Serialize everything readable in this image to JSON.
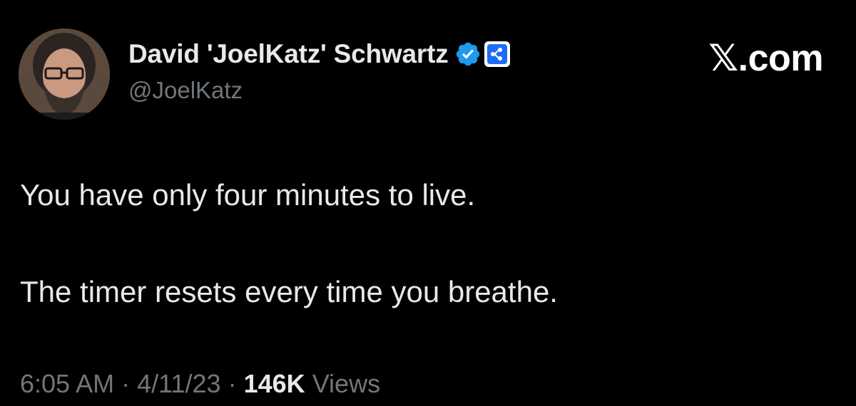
{
  "author": {
    "display_name": "David 'JoelKatz' Schwartz",
    "handle": "@JoelKatz",
    "verified_color": "#1d9bf0",
    "affiliate_color": "#1d6cf5"
  },
  "brand": {
    "label": "𝕏.com"
  },
  "tweet": {
    "lines": [
      "You have only four minutes to live.",
      "The timer resets every time you breathe."
    ]
  },
  "meta": {
    "time": "6:05 AM",
    "separator": "·",
    "date": "4/11/23",
    "views_count": "146K",
    "views_label": "Views"
  },
  "colors": {
    "background": "#000000",
    "text_primary": "#e7e9ea",
    "text_secondary": "#71767b"
  },
  "icons": {
    "verified": "verified-check-icon",
    "affiliate": "ripple-affiliate-icon"
  }
}
